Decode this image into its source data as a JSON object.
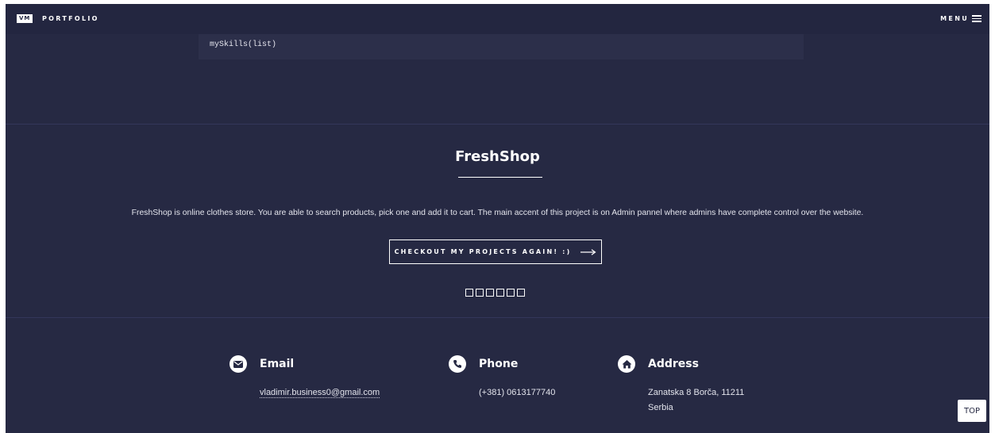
{
  "navbar": {
    "logo_initials": "VM",
    "logo_text": "PORTFOLIO",
    "menu_label": "MENU"
  },
  "code_block": {
    "text": "mySkills(list)"
  },
  "project": {
    "title": "FreshShop",
    "description": "FreshShop is online clothes store. You are able to search products, pick one and add it to cart. The main accent of this project is on Admin pannel where admins have complete control over the website.",
    "cta_label": "CHECKOUT MY PROJECTS AGAIN! :)",
    "pagination_dot_count": 6
  },
  "contact": {
    "email": {
      "title": "Email",
      "value": "vladimir.business0@gmail.com",
      "icon": "envelope-icon"
    },
    "phone": {
      "title": "Phone",
      "value": "(+381) 0613177740",
      "icon": "phone-icon"
    },
    "address": {
      "title": "Address",
      "line1": "Zanatska 8 Borča, 11211",
      "line2": "Serbia",
      "icon": "home-icon"
    }
  },
  "top_button": {
    "label": "TOP"
  },
  "colors": {
    "background": "#262943",
    "navbar": "#232640",
    "code_block": "#2c2f4a",
    "text": "#ffffff"
  }
}
